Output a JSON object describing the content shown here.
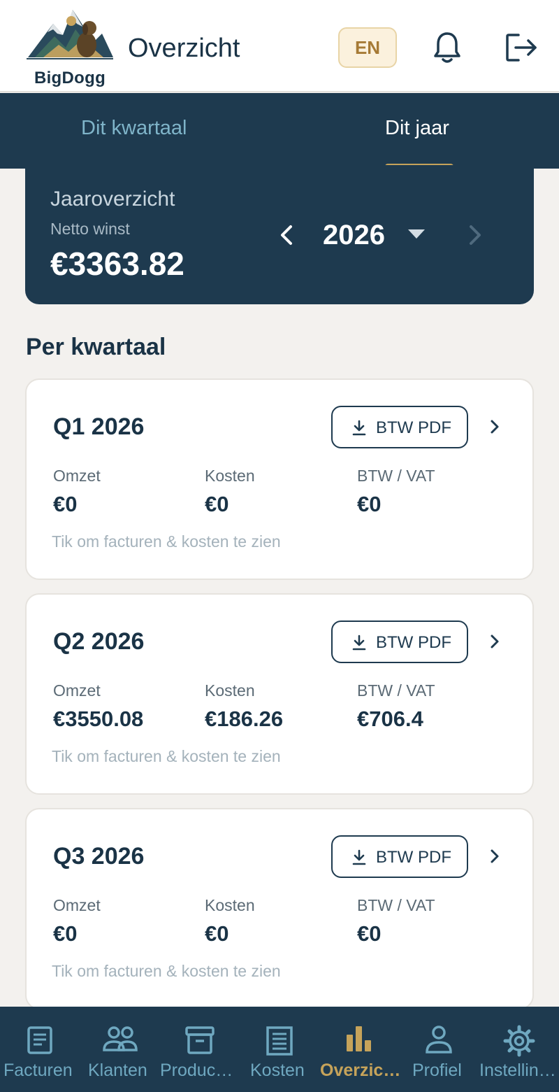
{
  "header": {
    "logo_text": "BigDogg",
    "title": "Overzicht",
    "language_button": "EN",
    "icons": [
      "bell-icon",
      "logout-icon"
    ]
  },
  "tabs": [
    {
      "label": "Dit kwartaal",
      "active": false
    },
    {
      "label": "Dit jaar",
      "active": true
    }
  ],
  "year_overview": {
    "title": "Jaaroverzicht",
    "subtitle": "Netto winst",
    "value": "€3363.82",
    "year": "2026"
  },
  "section_title": "Per kwartaal",
  "quarters": [
    {
      "title": "Q1 2026",
      "pdf_label": "BTW PDF",
      "stats": [
        {
          "label": "Omzet",
          "value": "€0"
        },
        {
          "label": "Kosten",
          "value": "€0"
        },
        {
          "label": "BTW / VAT",
          "value": "€0"
        }
      ],
      "hint": "Tik om facturen & kosten te zien"
    },
    {
      "title": "Q2 2026",
      "pdf_label": "BTW PDF",
      "stats": [
        {
          "label": "Omzet",
          "value": "€3550.08"
        },
        {
          "label": "Kosten",
          "value": "€186.26"
        },
        {
          "label": "BTW / VAT",
          "value": "€706.4"
        }
      ],
      "hint": "Tik om facturen & kosten te zien"
    },
    {
      "title": "Q3 2026",
      "pdf_label": "BTW PDF",
      "stats": [
        {
          "label": "Omzet",
          "value": "€0"
        },
        {
          "label": "Kosten",
          "value": "€0"
        },
        {
          "label": "BTW / VAT",
          "value": "€0"
        }
      ],
      "hint": "Tik om facturen & kosten te zien"
    }
  ],
  "bottom_nav": [
    {
      "label": "Facturen",
      "icon": "receipt-icon",
      "active": false
    },
    {
      "label": "Klanten",
      "icon": "users-icon",
      "active": false
    },
    {
      "label": "Produc…",
      "icon": "archive-box-icon",
      "active": false
    },
    {
      "label": "Kosten",
      "icon": "document-list-icon",
      "active": false
    },
    {
      "label": "Overzic…",
      "icon": "bar-chart-icon",
      "active": true
    },
    {
      "label": "Profiel",
      "icon": "person-icon",
      "active": false
    },
    {
      "label": "Instellin…",
      "icon": "gear-icon",
      "active": false
    }
  ],
  "colors": {
    "primary": "#1e3a4f",
    "accent": "#c6a35a",
    "background": "#f3f1ee",
    "tab_inactive": "#7fb4c9"
  }
}
